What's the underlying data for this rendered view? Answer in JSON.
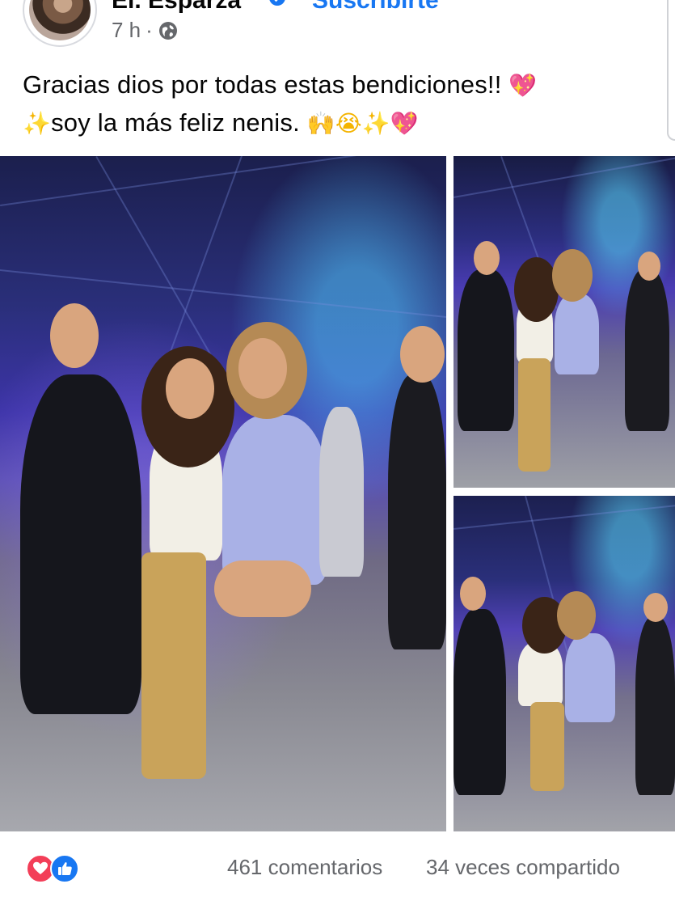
{
  "post": {
    "author_name": "Ei. Esparza",
    "subscribe_label": "Suscribirte",
    "timestamp": "7 h",
    "separator": "·",
    "caption_line1": "Gracias dios por todas estas bendiciones!!",
    "caption_line2": "soy la más feliz nenis.",
    "emoji_heart": "💖",
    "emoji_sparkles": "✨",
    "emoji_hands": "🙌",
    "emoji_cry": "😭",
    "icons": {
      "audience": "globe-icon",
      "verified": "verified-badge-icon"
    }
  },
  "photos": {
    "main_label": "Party photo main",
    "top_right_label": "Party photo 2",
    "bottom_right_label": "Party photo 3"
  },
  "footer": {
    "comments": "461 comentarios",
    "shares": "34 veces compartido",
    "reactions": [
      "love",
      "like"
    ]
  },
  "colors": {
    "accent": "#1877f2",
    "love": "#f33e58",
    "muted_text": "#65676b"
  }
}
